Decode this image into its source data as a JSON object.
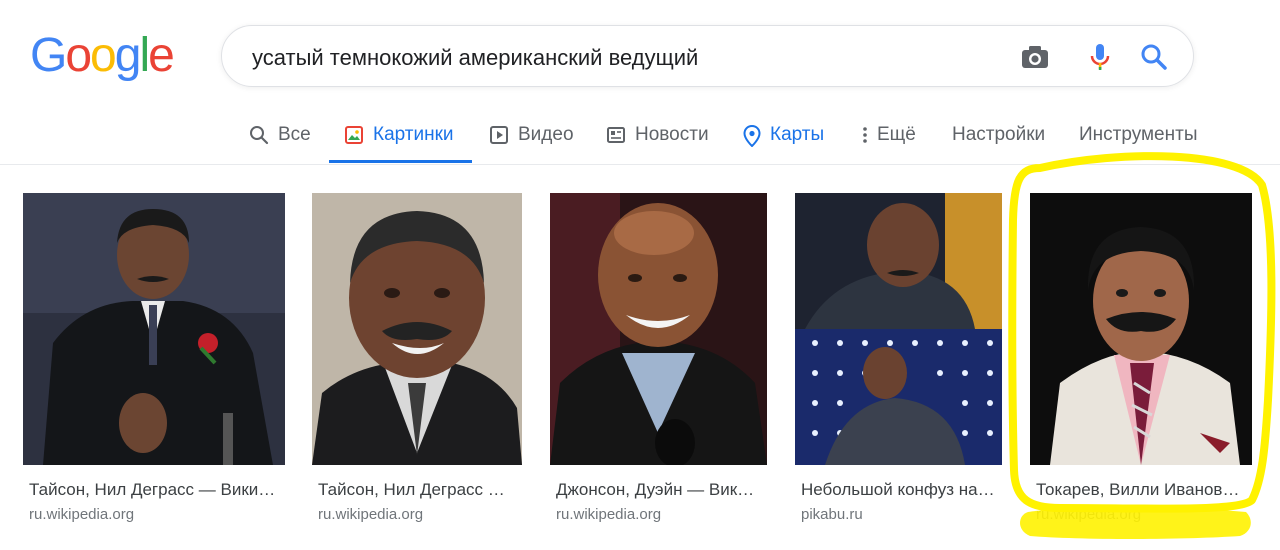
{
  "logo": {
    "text": "Google"
  },
  "search": {
    "query": "усатый темнокожий американский ведущий"
  },
  "tabs": [
    {
      "label": "Все",
      "icon": "search-icon",
      "active": false
    },
    {
      "label": "Картинки",
      "icon": "image-icon",
      "active": true
    },
    {
      "label": "Видео",
      "icon": "video-icon",
      "active": false
    },
    {
      "label": "Новости",
      "icon": "news-icon",
      "active": false
    },
    {
      "label": "Карты",
      "icon": "map-pin-icon",
      "active": false
    },
    {
      "label": "Ещё",
      "icon": "more-vert-icon",
      "active": false
    }
  ],
  "tools": {
    "settings": "Настройки",
    "tools": "Инструменты"
  },
  "results": [
    {
      "caption": "Тайсон, Нил Деграсс — Вики…",
      "source": "ru.wikipedia.org"
    },
    {
      "caption": "Тайсон, Нил Деграсс …",
      "source": "ru.wikipedia.org"
    },
    {
      "caption": "Джонсон, Дуэйн — Вик…",
      "source": "ru.wikipedia.org"
    },
    {
      "caption": "Небольшой конфуз на…",
      "source": "pikabu.ru"
    },
    {
      "caption": "Токарев, Вилли Иванов…",
      "source": "ru.wikipedia.org"
    }
  ],
  "colors": {
    "accent": "#1a73e8",
    "highlight": "#fff200",
    "google_blue": "#4285f4",
    "google_red": "#ea4335",
    "google_yellow": "#fbbc05",
    "google_green": "#34a853"
  }
}
